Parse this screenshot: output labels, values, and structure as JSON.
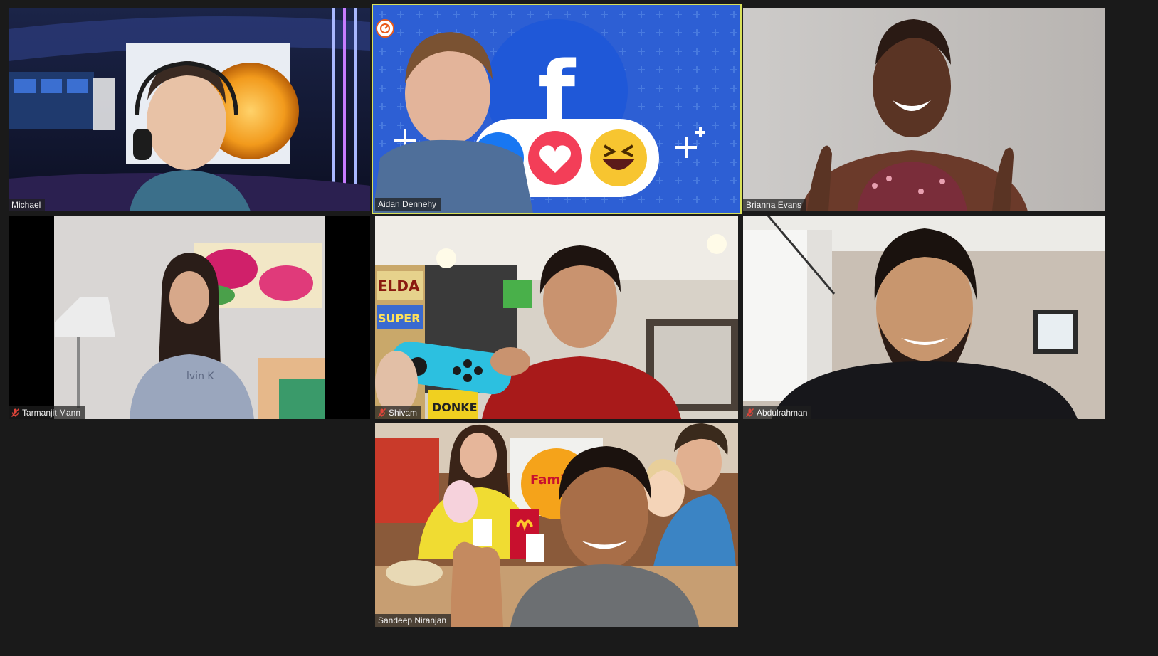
{
  "app": {
    "view": "Gallery View"
  },
  "participants": [
    {
      "id": "michael",
      "name": "Michael",
      "muted": false,
      "active_speaker": false
    },
    {
      "id": "aidan",
      "name": "Aidan Dennehy",
      "muted": false,
      "active_speaker": true
    },
    {
      "id": "brianna",
      "name": "Brianna Evans",
      "muted": false,
      "active_speaker": false
    },
    {
      "id": "tarmanjit",
      "name": "Tarmanjit Mann",
      "muted": true,
      "active_speaker": false
    },
    {
      "id": "shivam",
      "name": "Shivam",
      "muted": true,
      "active_speaker": false
    },
    {
      "id": "abdulrahman",
      "name": "Abdulrahman",
      "muted": true,
      "active_speaker": false
    },
    {
      "id": "sandeep",
      "name": "Sandeep Niranjan",
      "muted": false,
      "active_speaker": false
    }
  ],
  "background_text": {
    "family_night": "Family Night",
    "elda": "ELDA",
    "super": "SUPER 3",
    "donkey": "DONKE",
    "calvin": "lvin K"
  },
  "colors": {
    "window_bg": "#1a1a1a",
    "active_border": "#d8e05a",
    "muted_mic": "#e0453a",
    "facebook_blue": "#1877f2"
  }
}
